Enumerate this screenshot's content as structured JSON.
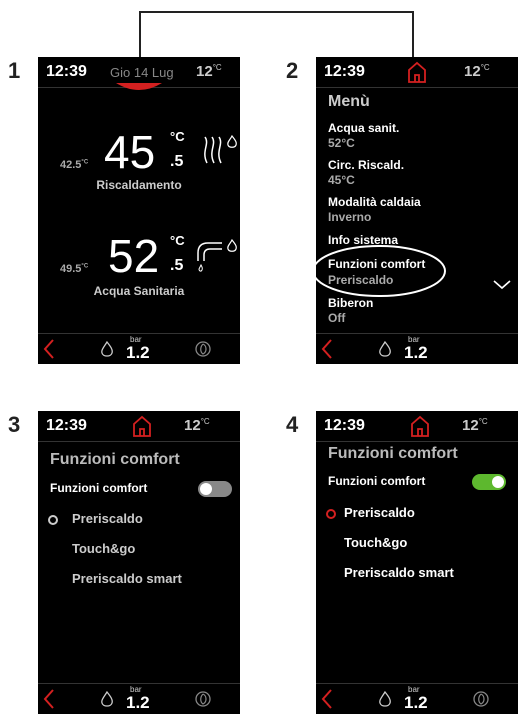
{
  "connector": {
    "from": "screen1-date",
    "to": "screen2-home-icon"
  },
  "screens": [
    {
      "number": "1",
      "status": {
        "time": "12:39",
        "date": "Gio 14 Lug",
        "temp": "12",
        "temp_unit": "°C"
      },
      "heating": {
        "value": "45",
        "unit": "°C",
        "decimal": ".5",
        "setpoint": "42.5",
        "setpoint_unit": "°C",
        "label": "Riscaldamento"
      },
      "water": {
        "value": "52",
        "unit": "°C",
        "decimal": ".5",
        "setpoint": "49.5",
        "setpoint_unit": "°C",
        "label": "Acqua Sanitaria"
      },
      "bottom": {
        "pressure": "1.2",
        "pressure_unit": "bar"
      },
      "accent_color": "#d42020"
    },
    {
      "number": "2",
      "status": {
        "time": "12:39",
        "temp": "12",
        "temp_unit": "°C"
      },
      "menu_title": "Menù",
      "items": [
        {
          "label": "Acqua sanit.",
          "value": "52°C"
        },
        {
          "label": "Circ. Riscald.",
          "value": "45°C"
        },
        {
          "label": "Modalità caldaia",
          "value": "Inverno"
        },
        {
          "label": "Info sistema",
          "value": ""
        },
        {
          "label": "Funzioni comfort",
          "value": "Preriscaldo"
        },
        {
          "label": "Biberon",
          "value": "Off"
        }
      ],
      "bottom": {
        "pressure": "1.2",
        "pressure_unit": "bar"
      }
    },
    {
      "number": "3",
      "status": {
        "time": "12:39",
        "temp": "12",
        "temp_unit": "°C"
      },
      "title": "Funzioni comfort",
      "toggle_label": "Funzioni comfort",
      "toggle_on": false,
      "options": [
        "Preriscaldo",
        "Touch&go",
        "Preriscaldo smart"
      ],
      "bottom": {
        "pressure": "1.2",
        "pressure_unit": "bar"
      }
    },
    {
      "number": "4",
      "status": {
        "time": "12:39",
        "temp": "12",
        "temp_unit": "°C"
      },
      "title": "Funzioni comfort",
      "toggle_label": "Funzioni comfort",
      "toggle_on": true,
      "toggle_color": "#5db82e",
      "options": [
        "Preriscaldo",
        "Touch&go",
        "Preriscaldo smart"
      ],
      "bottom": {
        "pressure": "1.2",
        "pressure_unit": "bar"
      }
    }
  ]
}
